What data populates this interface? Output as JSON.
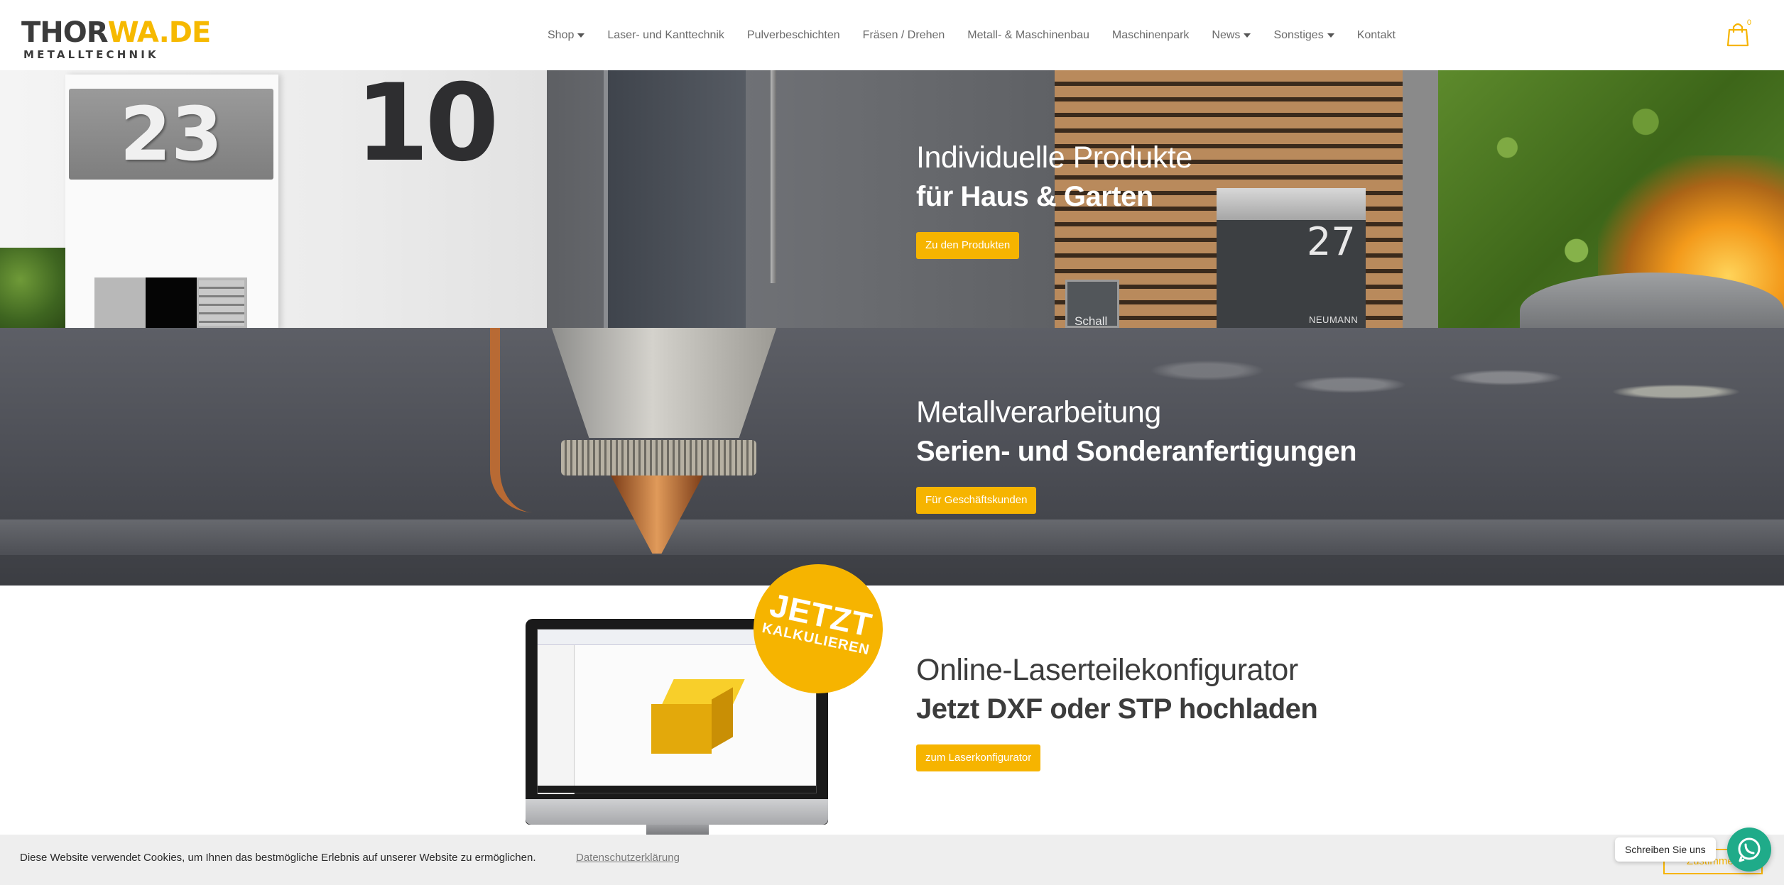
{
  "brand": {
    "logo_dark": "THOR",
    "logo_yellow": "WA.DE",
    "logo_sub": "METALLTECHNIK",
    "accent_color": "#f6b400"
  },
  "nav": {
    "items": [
      {
        "label": "Shop",
        "dropdown": true
      },
      {
        "label": "Laser- und Kanttechnik",
        "dropdown": false
      },
      {
        "label": "Pulverbeschichten",
        "dropdown": false
      },
      {
        "label": "Fräsen / Drehen",
        "dropdown": false
      },
      {
        "label": "Metall- & Maschinenbau",
        "dropdown": false
      },
      {
        "label": "Maschinenpark",
        "dropdown": false
      },
      {
        "label": "News",
        "dropdown": true
      },
      {
        "label": "Sonstiges",
        "dropdown": true
      },
      {
        "label": "Kontakt",
        "dropdown": false
      }
    ],
    "cart_icon": "shopping-bag-icon",
    "cart_count": "0"
  },
  "banner1": {
    "plate_number": "23",
    "house_number": "10",
    "mailbox_number": "27",
    "mailbox_name": "NEUMANN",
    "intercom_label": "Schall",
    "title_light": "Individuelle Produkte",
    "title_bold": "für Haus & Garten",
    "button": "Zu den Produkten"
  },
  "banner2": {
    "title_light": "Metallverarbeitung",
    "title_bold": "Serien- und Sonderanfertigungen",
    "button": "Für Geschäftskunden"
  },
  "configurator": {
    "badge_line1": "JETZT",
    "badge_line2": "KALKULIEREN",
    "title_light": "Online-Laserteilekonfigurator",
    "title_bold": "Jetzt DXF oder STP hochladen",
    "button": "zum Laserkonfigurator"
  },
  "cookie": {
    "text": "Diese Website verwendet Cookies, um Ihnen das bestmögliche Erlebnis auf unserer Website zu ermöglichen.",
    "link": "Datenschutzerklärung",
    "accept_button": "Zustimmen"
  },
  "whatsapp": {
    "label": "Schreiben Sie uns",
    "icon": "whatsapp-icon"
  }
}
